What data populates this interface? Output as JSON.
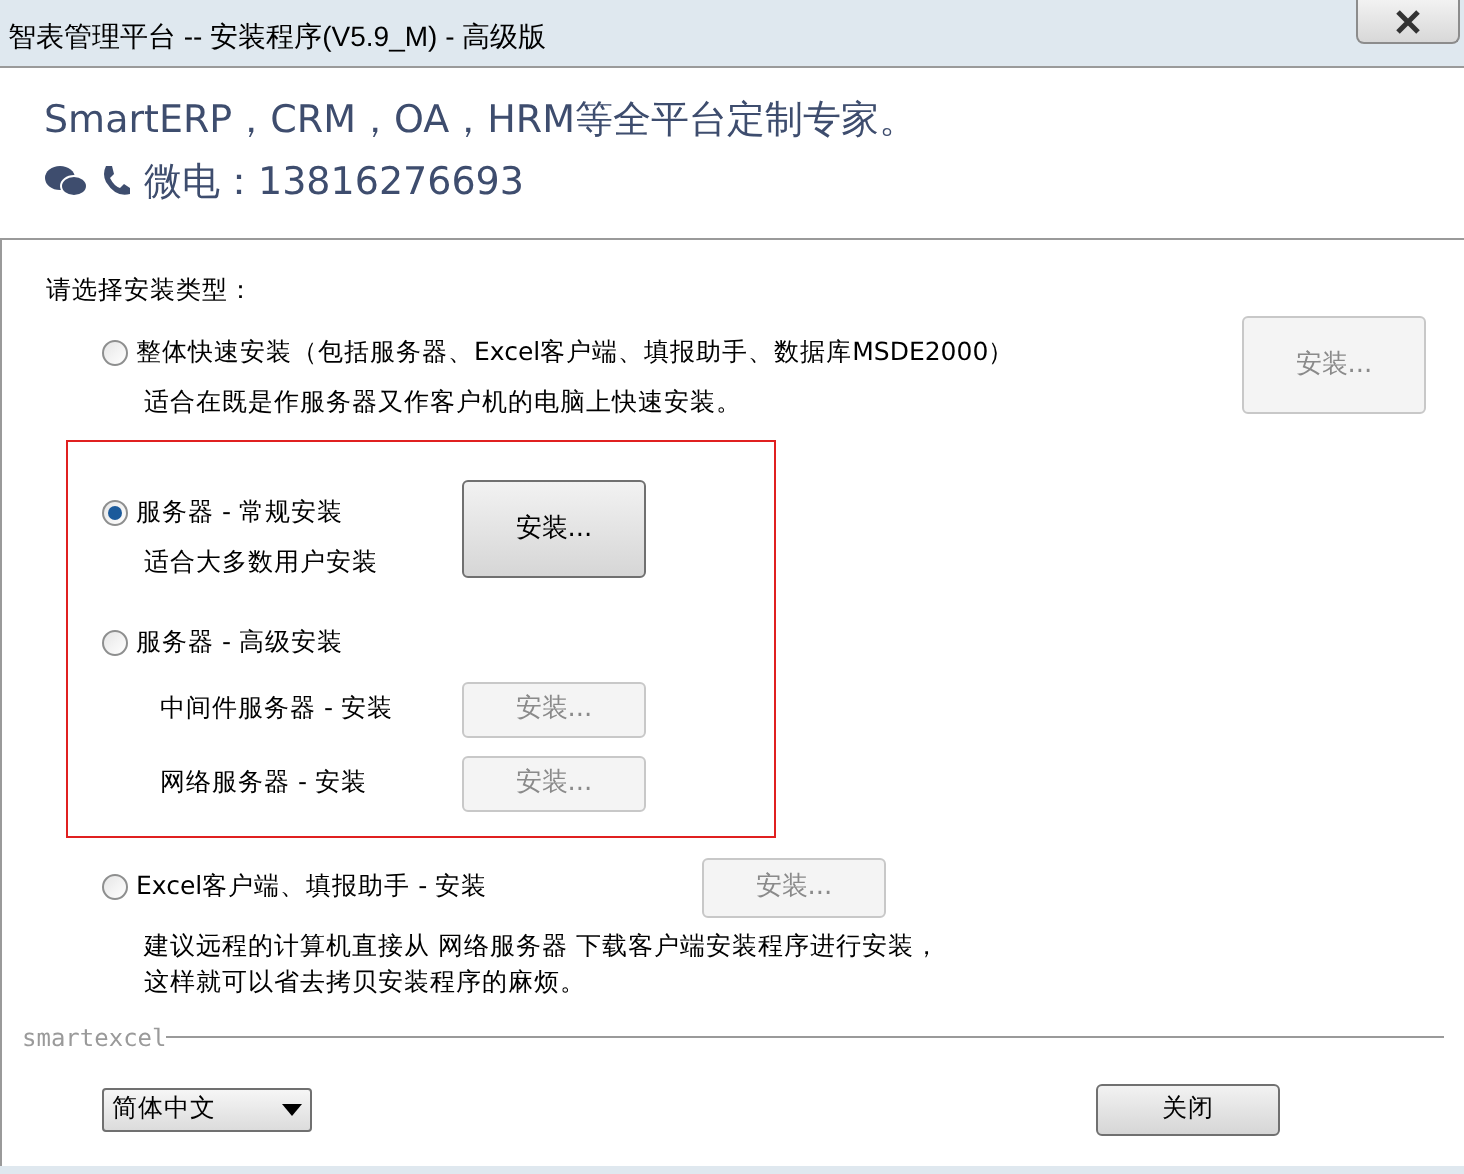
{
  "window": {
    "title": "智表管理平台 -- 安装程序(V5.9_M) - 高级版"
  },
  "banner": {
    "headline": "SmartERP，CRM，OA，HRM等全平台定制专家。",
    "contact": "微电：13816276693"
  },
  "prompt": "请选择安装类型：",
  "options": [
    {
      "label": "整体快速安装（包括服务器、Excel客户端、填报助手、数据库MSDE2000）",
      "selected": false,
      "highlighted": false,
      "description": [
        "适合在既是作服务器又作客户机的电脑上快速安装。"
      ],
      "button": {
        "label": "安装...",
        "disabled": true
      }
    },
    {
      "label": "服务器 - 常规安装",
      "selected": true,
      "highlighted": true,
      "description": [
        "适合大多数用户安装"
      ],
      "button": {
        "label": "安装...",
        "disabled": false
      }
    },
    {
      "label": "服务器 - 高级安装",
      "selected": false,
      "highlighted": true,
      "sub_items": [
        {
          "label": "中间件服务器 - 安装",
          "button": {
            "label": "安装...",
            "disabled": true
          }
        },
        {
          "label": "网络服务器 - 安装",
          "button": {
            "label": "安装...",
            "disabled": true
          }
        }
      ]
    },
    {
      "label": "Excel客户端、填报助手 - 安装",
      "selected": false,
      "highlighted": false,
      "description": [
        "建议远程的计算机直接从 网络服务器 下载客户端安装程序进行安装，",
        "这样就可以省去拷贝安装程序的麻烦。"
      ],
      "button": {
        "label": "安装...",
        "disabled": true
      }
    }
  ],
  "footer": {
    "group_label": "smartexcel",
    "language": "简体中文",
    "close_button": "关闭"
  }
}
